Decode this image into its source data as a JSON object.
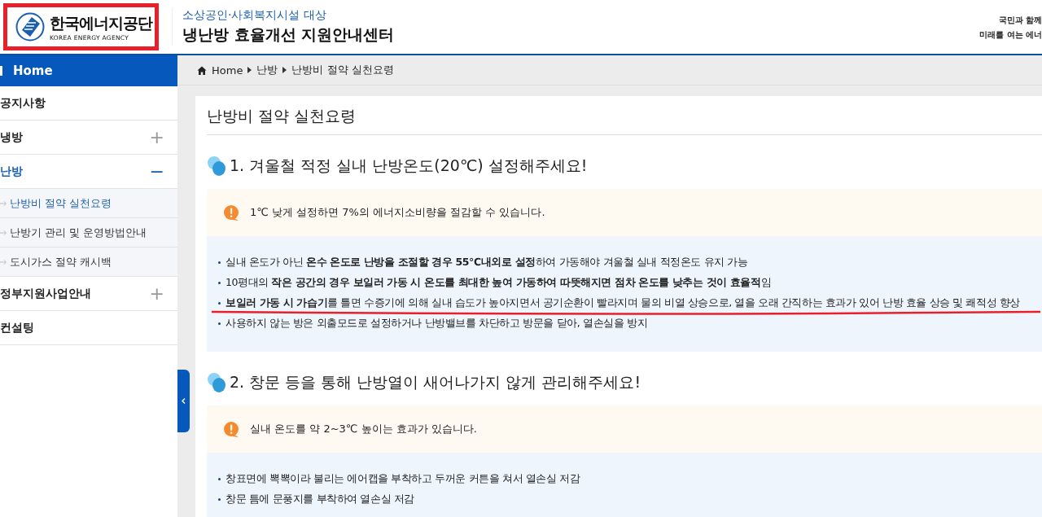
{
  "header": {
    "logo": {
      "name": "한국에너지공단",
      "subtitle": "KOREA ENERGY AGENCY",
      "highlighted": true
    },
    "tagline": "소상공인·사회복지시설 대상",
    "site_title": "냉난방 효율개선 지원안내센터",
    "slogan": [
      "국민과 함께",
      "미래를 여는 에너"
    ]
  },
  "sidebar": {
    "home": "Home",
    "items": [
      {
        "label": "공지사항",
        "selected": false
      },
      {
        "label": "냉방",
        "toggle": "+",
        "selected": false
      },
      {
        "label": "난방",
        "toggle": "−",
        "selected": true,
        "children": [
          {
            "label": "난방비 절약 실천요령",
            "selected": true
          },
          {
            "label": "난방기 관리 및 운영방법안내",
            "selected": false
          },
          {
            "label": "도시가스 절약 캐시백",
            "selected": false
          }
        ]
      },
      {
        "label": "정부지원사업안내",
        "toggle": "+",
        "selected": false
      },
      {
        "label": "컨설팅",
        "selected": false
      }
    ]
  },
  "breadcrumb": [
    "Home",
    "난방",
    "난방비 절약 실천요령"
  ],
  "page_title": "난방비 절약 실천요령",
  "sections": [
    {
      "heading": "1. 겨울철 적정 실내 난방온도(20℃) 설정해주세요!",
      "note": "1℃ 낮게 설정하면 7%의 에너지소비량을 절감할 수 있습니다.",
      "bullets": [
        {
          "text": "실내 온도가 아닌 **온수 온도로 난방을 조절할 경우 55℃내외로 설정**하여 가동해야 겨울철 실내 적정온도 유지 가능",
          "underlined": false
        },
        {
          "text": "10평대의 **작은 공간의 경우 보일러 가동 시 온도를 최대한 높여 가동하여 따뜻해지면 점차 온도를 낮추는 것이 효율적**임",
          "underlined": false
        },
        {
          "text": "**보일러 가동 시 가습기**를 틀면 수증기에 의해 실내 습도가 높아지면서 공기순환이 빨라지며 물의 비열 상승으로, 열을 오래 간직하는 효과가 있어 난방 효율 상승 및 쾌적성 향상",
          "underlined": true
        },
        {
          "text": "사용하지 않는 방은 외출모드로 설정하거나 난방밸브를 차단하고 방문을 닫아, 열손실을 방지",
          "underlined": false
        }
      ]
    },
    {
      "heading": "2. 창문 등을 통해 난방열이 새어나가지 않게 관리해주세요!",
      "note": "실내 온도를 약 2~3℃ 높이는 효과가 있습니다.",
      "bullets": [
        {
          "text": "창표면에 뽁뽁이라 불리는 에어캡을 부착하고 두꺼운 커튼을 쳐서 열손실 저감",
          "underlined": false
        },
        {
          "text": "창문 틈에 문풍지를 부착하여 열손실 저감",
          "underlined": false
        }
      ]
    }
  ]
}
